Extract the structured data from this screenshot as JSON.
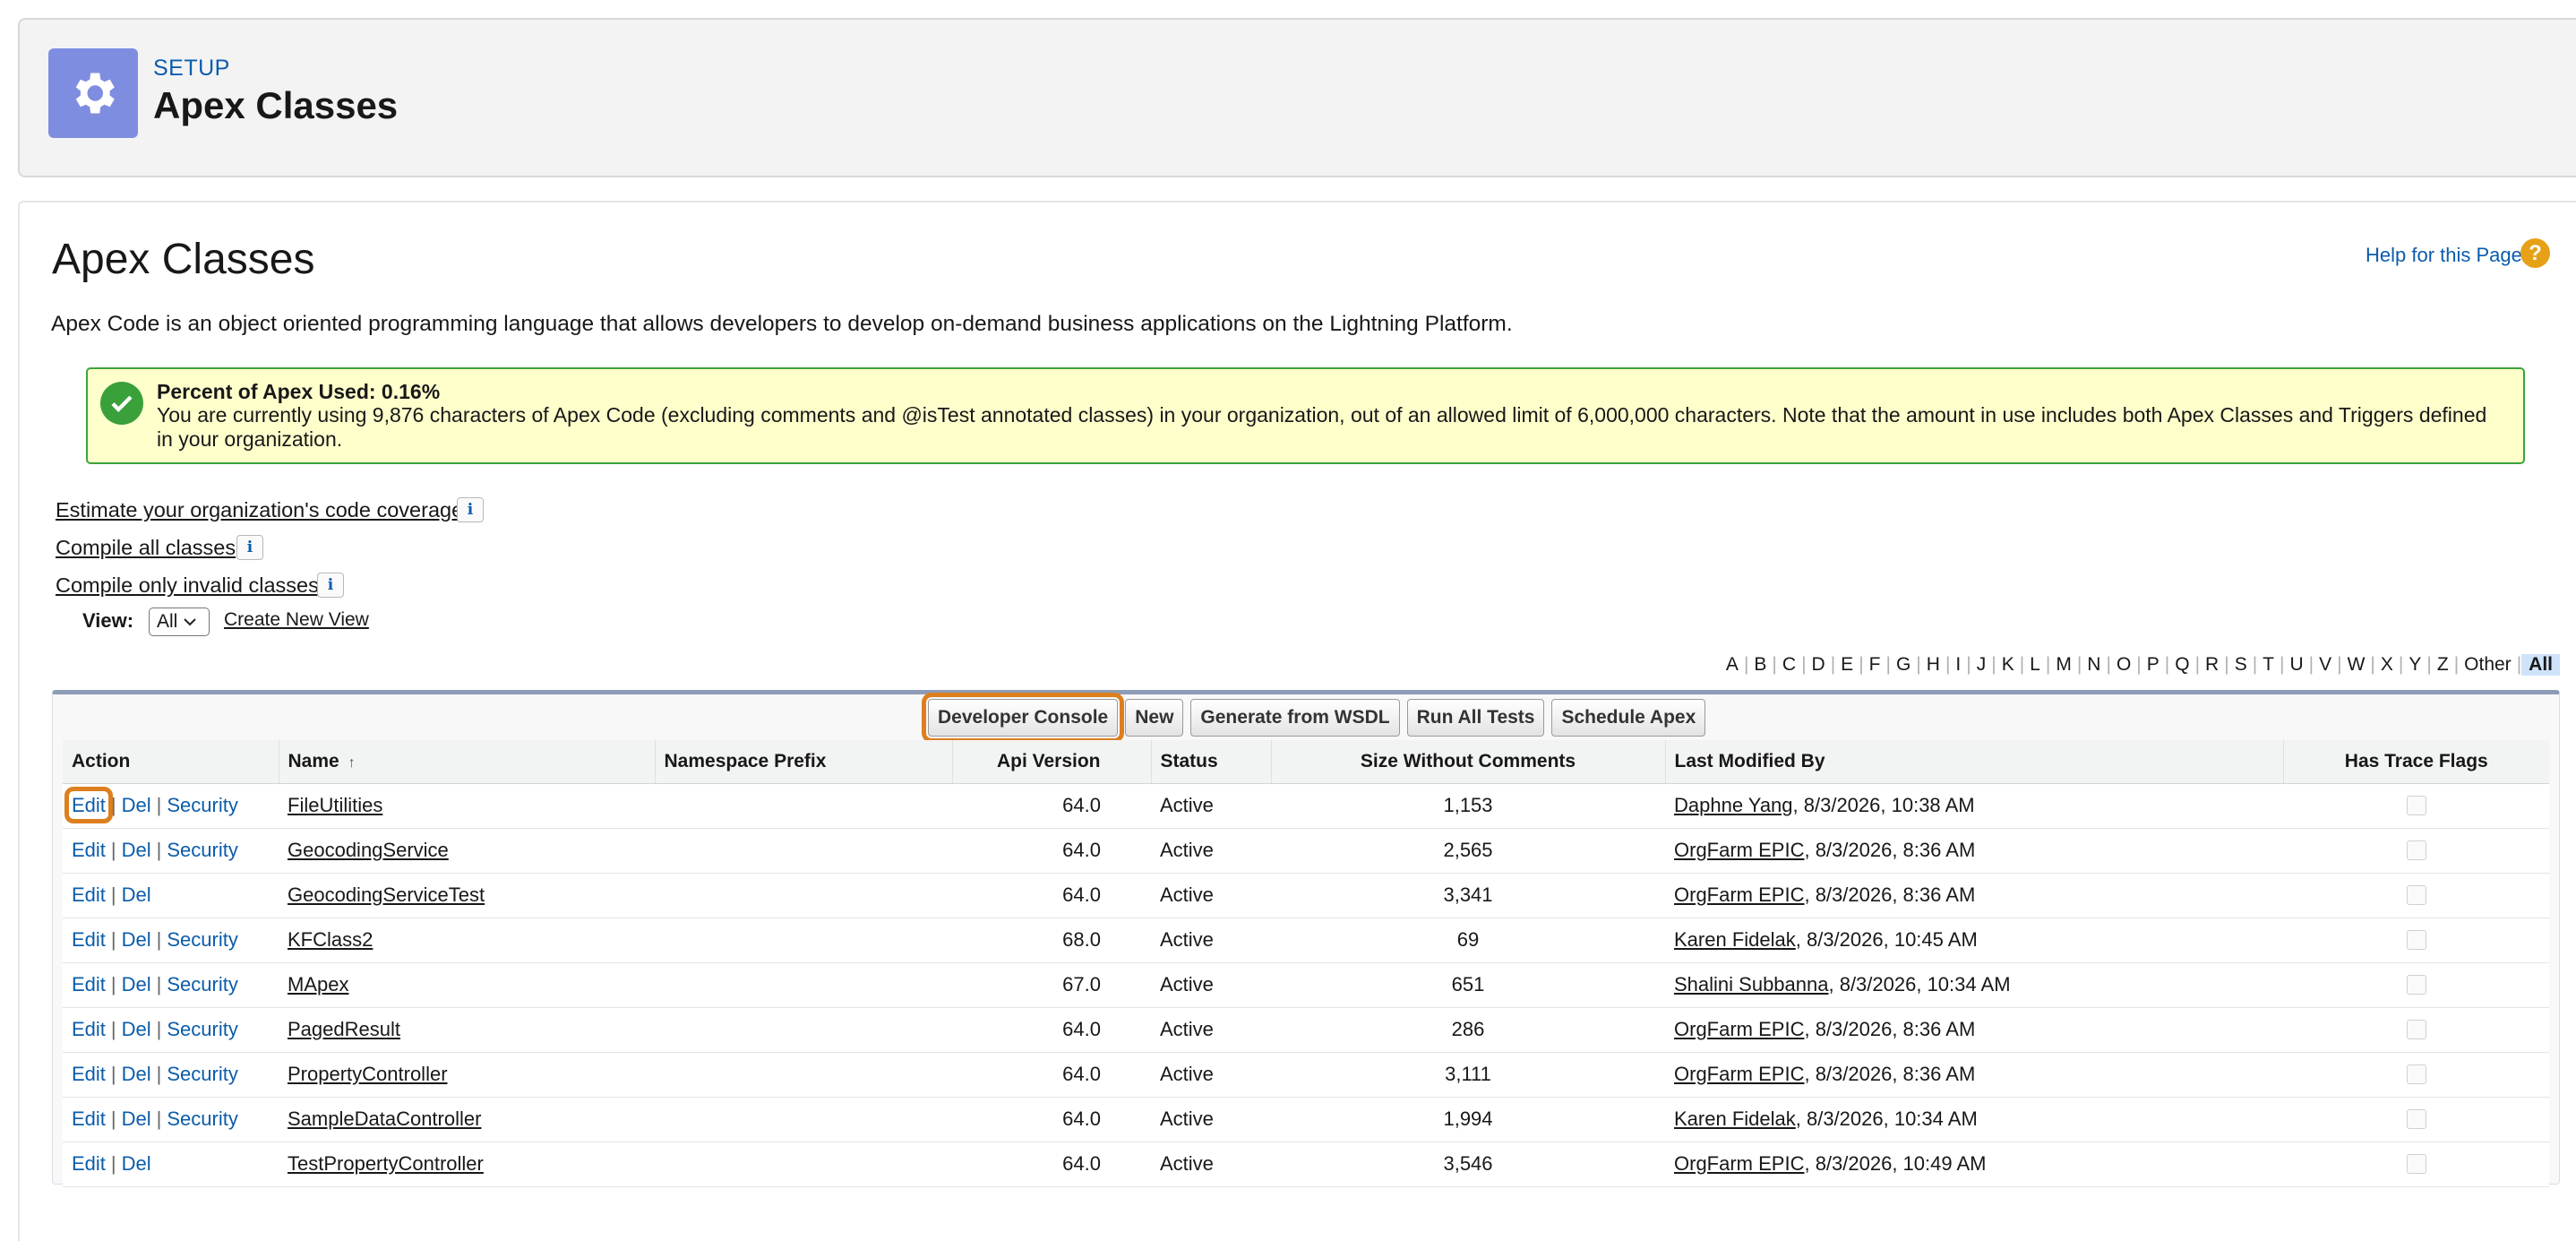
{
  "header": {
    "breadcrumb": "SETUP",
    "title": "Apex Classes",
    "icon": "gear-icon"
  },
  "main": {
    "title": "Apex Classes",
    "help_link": "Help for this Page",
    "help_icon": "?",
    "description": "Apex Code is an object oriented programming language that allows developers to develop on-demand business applications on the Lightning Platform.",
    "usage": {
      "title": "Percent of Apex Used: 0.16%",
      "text": "You are currently using 9,876 characters of Apex Code (excluding comments and @isTest annotated classes) in your organization, out of an allowed limit of 6,000,000 characters. Note that the amount in use includes both Apex Classes and Triggers defined in your organization."
    },
    "links": {
      "estimate": "Estimate your organization's code coverage",
      "compile_all": "Compile all classes",
      "compile_invalid": "Compile only invalid classes",
      "info_glyph": "i"
    },
    "view": {
      "label": "View:",
      "selected": "All",
      "create_new": "Create New View"
    },
    "alpha": [
      "A",
      "B",
      "C",
      "D",
      "E",
      "F",
      "G",
      "H",
      "I",
      "J",
      "K",
      "L",
      "M",
      "N",
      "O",
      "P",
      "Q",
      "R",
      "S",
      "T",
      "U",
      "V",
      "W",
      "X",
      "Y",
      "Z",
      "Other",
      "All"
    ],
    "buttons": {
      "dev_console": "Developer Console",
      "new": "New",
      "wsdl": "Generate from WSDL",
      "run_tests": "Run All Tests",
      "schedule": "Schedule Apex"
    },
    "columns": {
      "action": "Action",
      "name": "Name",
      "sort_glyph": "↑",
      "namespace": "Namespace Prefix",
      "api": "Api Version",
      "status": "Status",
      "size": "Size Without Comments",
      "modified": "Last Modified By",
      "trace": "Has Trace Flags"
    },
    "actions": {
      "edit": "Edit",
      "del": "Del",
      "security": "Security",
      "sep": "|"
    },
    "rows": [
      {
        "name": "FileUtilities",
        "api": "64.0",
        "status": "Active",
        "size": "1,153",
        "user": "Daphne Yang",
        "date": ", 8/3/2026, 10:38 AM",
        "security": true
      },
      {
        "name": "GeocodingService",
        "api": "64.0",
        "status": "Active",
        "size": "2,565",
        "user": "OrgFarm EPIC",
        "date": ", 8/3/2026, 8:36 AM",
        "security": true
      },
      {
        "name": "GeocodingServiceTest",
        "api": "64.0",
        "status": "Active",
        "size": "3,341",
        "user": "OrgFarm EPIC",
        "date": ", 8/3/2026, 8:36 AM",
        "security": false
      },
      {
        "name": "KFClass2",
        "api": "68.0",
        "status": "Active",
        "size": "69",
        "user": "Karen Fidelak",
        "date": ", 8/3/2026, 10:45 AM",
        "security": true
      },
      {
        "name": "MApex",
        "api": "67.0",
        "status": "Active",
        "size": "651",
        "user": "Shalini Subbanna",
        "date": ", 8/3/2026, 10:34 AM",
        "security": true
      },
      {
        "name": "PagedResult",
        "api": "64.0",
        "status": "Active",
        "size": "286",
        "user": "OrgFarm EPIC",
        "date": ", 8/3/2026, 8:36 AM",
        "security": true
      },
      {
        "name": "PropertyController",
        "api": "64.0",
        "status": "Active",
        "size": "3,111",
        "user": "OrgFarm EPIC",
        "date": ", 8/3/2026, 8:36 AM",
        "security": true
      },
      {
        "name": "SampleDataController",
        "api": "64.0",
        "status": "Active",
        "size": "1,994",
        "user": "Karen Fidelak",
        "date": ", 8/3/2026, 10:34 AM",
        "security": true
      },
      {
        "name": "TestPropertyController",
        "api": "64.0",
        "status": "Active",
        "size": "3,546",
        "user": "OrgFarm EPIC",
        "date": ", 8/3/2026, 10:49 AM",
        "security": false
      }
    ]
  }
}
